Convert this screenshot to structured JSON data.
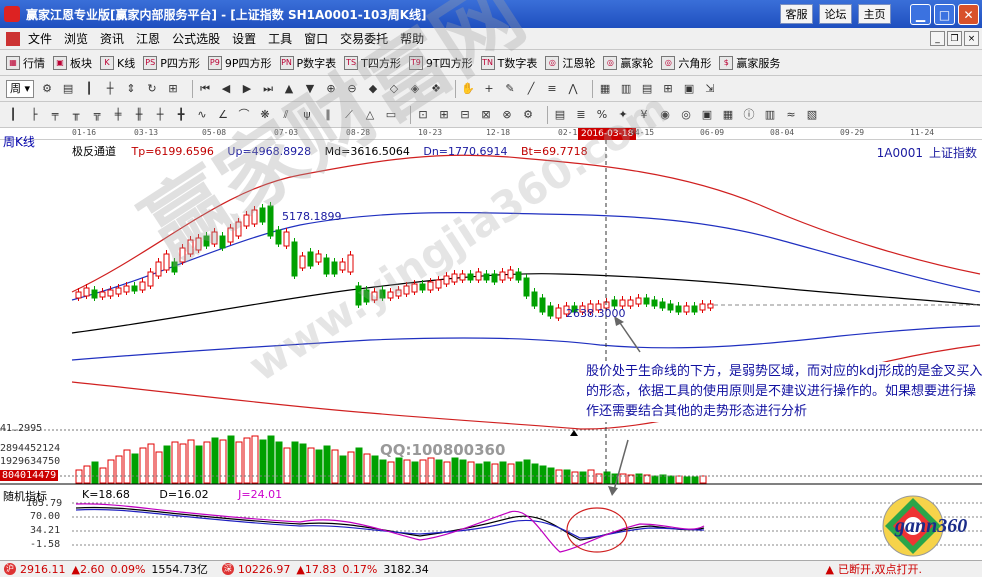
{
  "app": {
    "title": "赢家江恩专业版[赢家内部服务平台] - [上证指数   SH1A0001-103周K线]",
    "top_buttons": [
      "客服",
      "论坛",
      "主页"
    ]
  },
  "menu": [
    "文件",
    "浏览",
    "资讯",
    "江恩",
    "公式选股",
    "设置",
    "工具",
    "窗口",
    "交易委托",
    "帮助"
  ],
  "toolbar1": [
    {
      "icon": "list-icon",
      "glyph": "▦",
      "label": "行情"
    },
    {
      "icon": "blocks-icon",
      "glyph": "▣",
      "label": "板块"
    },
    {
      "icon": "kline-icon",
      "glyph": "K",
      "label": "K线"
    },
    {
      "icon": "p-square-icon",
      "glyph": "PS",
      "label": "P四方形"
    },
    {
      "icon": "9p-square-icon",
      "glyph": "P9",
      "label": "9P四方形"
    },
    {
      "icon": "p-number-icon",
      "glyph": "PN",
      "label": "P数字表"
    },
    {
      "icon": "t-square-icon",
      "glyph": "TS",
      "label": "T四方形"
    },
    {
      "icon": "9t-square-icon",
      "glyph": "T9",
      "label": "9T四方形"
    },
    {
      "icon": "t-number-icon",
      "glyph": "TN",
      "label": "T数字表"
    },
    {
      "icon": "gann-wheel-icon",
      "glyph": "◎",
      "label": "江恩轮"
    },
    {
      "icon": "winner-wheel-icon",
      "glyph": "◎",
      "label": "赢家轮"
    },
    {
      "icon": "hexagon-icon",
      "glyph": "◎",
      "label": "六角形"
    },
    {
      "icon": "dollar-icon",
      "glyph": "$",
      "label": "赢家服务"
    }
  ],
  "period": "周",
  "dates": [
    "01-16",
    "03-13",
    "05-08",
    "07-03",
    "08-28",
    "10-23",
    "12-18",
    "02-1",
    "04-15",
    "06-09",
    "08-04",
    "09-29",
    "11-24"
  ],
  "current_date": "2016-03-18",
  "panel_name": "周K线",
  "indicator": {
    "name": "极反通道",
    "values": [
      "Tp=6199.6596",
      "Up=4968.8928",
      "Md=3616.5064",
      "Dn=1770.6914",
      "Bt=69.7718"
    ],
    "colors": [
      "#c00000",
      "#1a1aa0",
      "#000000",
      "#1a1aa0",
      "#c00000"
    ]
  },
  "symbol": {
    "code": "1A0001",
    "name": "上证指数"
  },
  "labels": {
    "high": "5178.1899",
    "low": "2638.3000"
  },
  "volume_axis": [
    "41.2995",
    "2894452124",
    "1929634750",
    "804014479"
  ],
  "annotation": "股价处于生命线的下方，是弱势区域，而对应的kdj形成的是金叉买入的形态，依据工具的使用原则是不建议进行操作的。如果想要进行操作还需要结合其他的走势形态进行分析",
  "qq": "QQ:100800360",
  "watermark": "赢家财富网",
  "watermark2": "www.yingjia360.com",
  "kdj": {
    "name": "随机指标",
    "k": "K=18.68",
    "d": "D=16.02",
    "j": "J=24.01",
    "axis": [
      "105.79",
      "70.00",
      "34.21",
      "-1.58"
    ]
  },
  "logo": "gann360",
  "status": {
    "sh": {
      "price": "2916.11",
      "change": "▲2.60",
      "pct": "0.09%",
      "amount": "1554.73亿"
    },
    "sz": {
      "price": "10226.97",
      "change": "▲17.83",
      "pct": "0.17%",
      "amount": "3182.34"
    },
    "message": "已断开,双点打开."
  },
  "colors": {
    "up": "#e00000",
    "down": "#00a000",
    "title_bg": "#2a5bd0",
    "annotation": "#1010a0"
  }
}
